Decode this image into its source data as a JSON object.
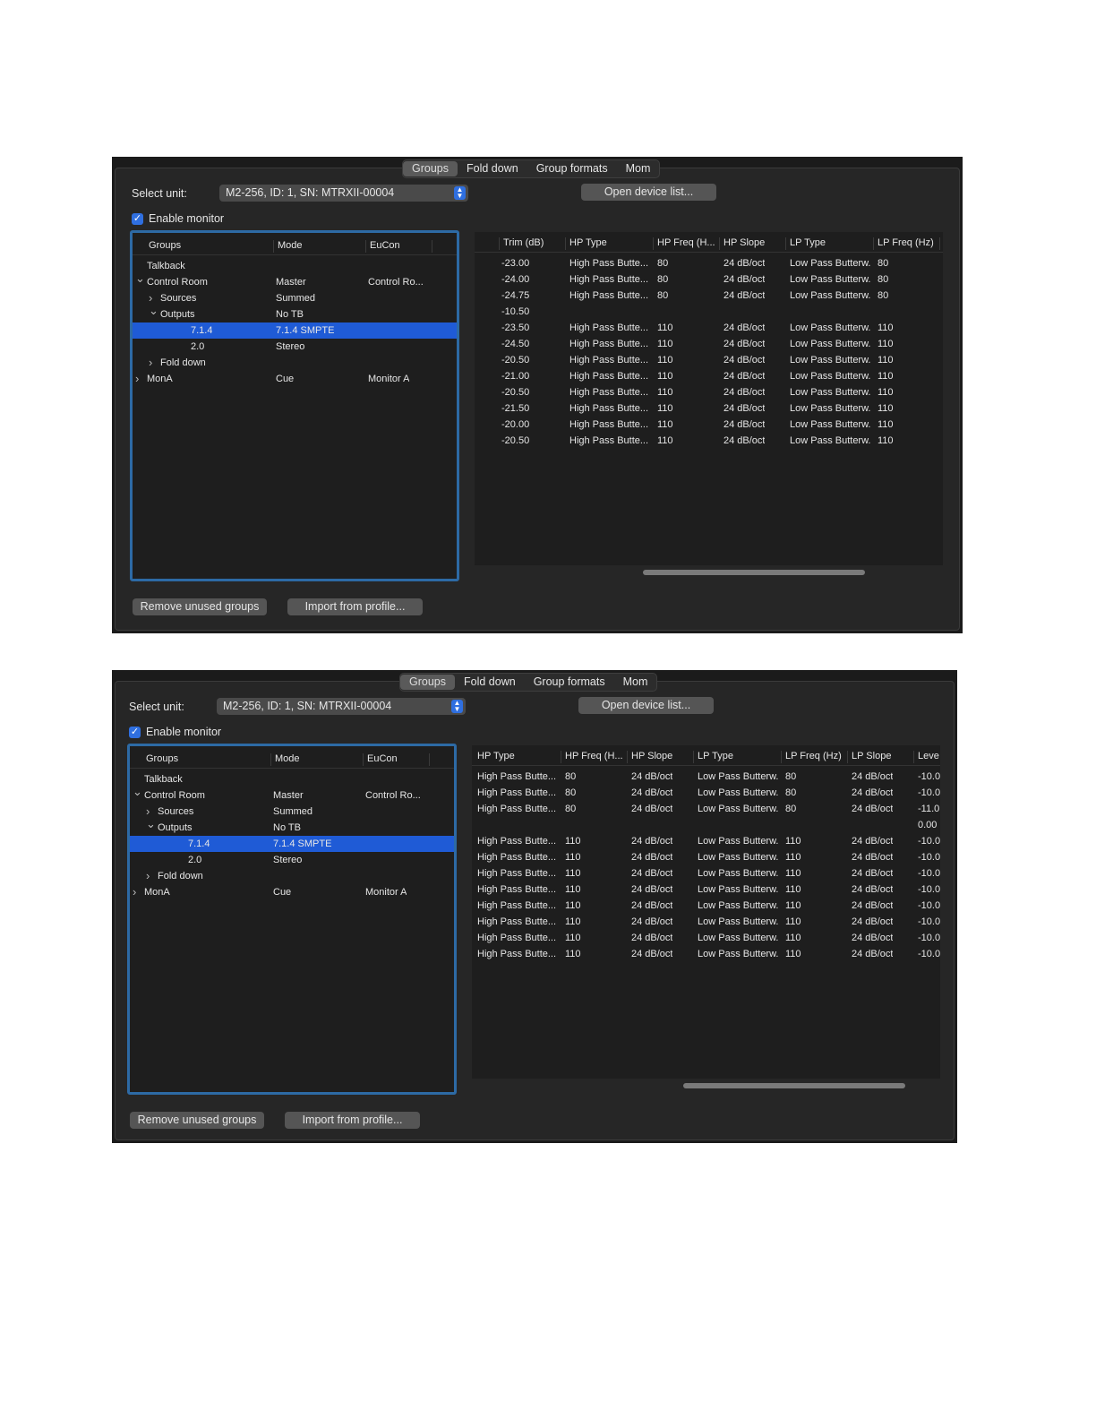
{
  "panels": [
    {
      "tabs": [
        "Groups",
        "Fold down",
        "Group formats",
        "Mom"
      ],
      "selected_tab": 0,
      "select_unit_label": "Select unit:",
      "unit_value": "M2-256, ID: 1, SN: MTRXII-00004",
      "open_device_list": "Open device list...",
      "enable_monitor": "Enable monitor",
      "enable_monitor_checked": true,
      "groups_table": {
        "columns": [
          "Groups",
          "Mode",
          "EuCon"
        ],
        "rows": [
          {
            "name": "Talkback",
            "mode": "",
            "eucon": "",
            "level": 0,
            "chevron": ""
          },
          {
            "name": "Control Room",
            "mode": "Master",
            "eucon": "Control Ro...",
            "level": 0,
            "chevron": "⌄"
          },
          {
            "name": "Sources",
            "mode": "Summed",
            "eucon": "",
            "level": 1,
            "chevron": "›"
          },
          {
            "name": "Outputs",
            "mode": "No TB",
            "eucon": "",
            "level": 1,
            "chevron": "⌄"
          },
          {
            "name": "7.1.4",
            "mode": "7.1.4 SMPTE",
            "eucon": "",
            "level": 2,
            "chevron": "",
            "selected": true
          },
          {
            "name": "2.0",
            "mode": "Stereo",
            "eucon": "",
            "level": 2,
            "chevron": ""
          },
          {
            "name": "Fold down",
            "mode": "",
            "eucon": "",
            "level": 1,
            "chevron": "›"
          },
          {
            "name": "MonA",
            "mode": "Cue",
            "eucon": "Monitor A",
            "level": 0,
            "chevron": "›"
          }
        ]
      },
      "channel_table": {
        "columns": [
          "Trim (dB)",
          "HP Type",
          "HP Freq (H...",
          "HP Slope",
          "LP Type",
          "LP Freq (Hz)"
        ],
        "rows": [
          [
            "-23.00",
            "High Pass Butte...",
            "80",
            "24 dB/oct",
            "Low Pass Butterw.",
            "80"
          ],
          [
            "-24.00",
            "High Pass Butte...",
            "80",
            "24 dB/oct",
            "Low Pass Butterw.",
            "80"
          ],
          [
            "-24.75",
            "High Pass Butte...",
            "80",
            "24 dB/oct",
            "Low Pass Butterw.",
            "80"
          ],
          [
            "-10.50",
            "",
            "",
            "",
            "",
            ""
          ],
          [
            "-23.50",
            "High Pass Butte...",
            "110",
            "24 dB/oct",
            "Low Pass Butterw.",
            "110"
          ],
          [
            "-24.50",
            "High Pass Butte...",
            "110",
            "24 dB/oct",
            "Low Pass Butterw.",
            "110"
          ],
          [
            "-20.50",
            "High Pass Butte...",
            "110",
            "24 dB/oct",
            "Low Pass Butterw.",
            "110"
          ],
          [
            "-21.00",
            "High Pass Butte...",
            "110",
            "24 dB/oct",
            "Low Pass Butterw.",
            "110"
          ],
          [
            "-20.50",
            "High Pass Butte...",
            "110",
            "24 dB/oct",
            "Low Pass Butterw.",
            "110"
          ],
          [
            "-21.50",
            "High Pass Butte...",
            "110",
            "24 dB/oct",
            "Low Pass Butterw.",
            "110"
          ],
          [
            "-20.00",
            "High Pass Butte...",
            "110",
            "24 dB/oct",
            "Low Pass Butterw.",
            "110"
          ],
          [
            "-20.50",
            "High Pass Butte...",
            "110",
            "24 dB/oct",
            "Low Pass Butterw.",
            "110"
          ]
        ]
      },
      "remove_unused": "Remove unused groups",
      "import_profile": "Import from profile..."
    },
    {
      "tabs": [
        "Groups",
        "Fold down",
        "Group formats",
        "Mom"
      ],
      "selected_tab": 0,
      "select_unit_label": "Select unit:",
      "unit_value": "M2-256, ID: 1, SN: MTRXII-00004",
      "open_device_list": "Open device list...",
      "enable_monitor": "Enable monitor",
      "enable_monitor_checked": true,
      "groups_table": {
        "columns": [
          "Groups",
          "Mode",
          "EuCon"
        ],
        "rows": [
          {
            "name": "Talkback",
            "mode": "",
            "eucon": "",
            "level": 0,
            "chevron": ""
          },
          {
            "name": "Control Room",
            "mode": "Master",
            "eucon": "Control Ro...",
            "level": 0,
            "chevron": "⌄"
          },
          {
            "name": "Sources",
            "mode": "Summed",
            "eucon": "",
            "level": 1,
            "chevron": "›"
          },
          {
            "name": "Outputs",
            "mode": "No TB",
            "eucon": "",
            "level": 1,
            "chevron": "⌄"
          },
          {
            "name": "7.1.4",
            "mode": "7.1.4 SMPTE",
            "eucon": "",
            "level": 2,
            "chevron": "",
            "selected": true
          },
          {
            "name": "2.0",
            "mode": "Stereo",
            "eucon": "",
            "level": 2,
            "chevron": ""
          },
          {
            "name": "Fold down",
            "mode": "",
            "eucon": "",
            "level": 1,
            "chevron": "›"
          },
          {
            "name": "MonA",
            "mode": "Cue",
            "eucon": "Monitor A",
            "level": 0,
            "chevron": "›"
          }
        ]
      },
      "channel_table": {
        "columns": [
          "HP Type",
          "HP Freq (H...",
          "HP Slope",
          "LP Type",
          "LP Freq (Hz)",
          "LP Slope",
          "Leve"
        ],
        "rows": [
          [
            "High Pass Butte...",
            "80",
            "24 dB/oct",
            "Low Pass Butterw.",
            "80",
            "24 dB/oct",
            "-10.0"
          ],
          [
            "High Pass Butte...",
            "80",
            "24 dB/oct",
            "Low Pass Butterw.",
            "80",
            "24 dB/oct",
            "-10.0"
          ],
          [
            "High Pass Butte...",
            "80",
            "24 dB/oct",
            "Low Pass Butterw.",
            "80",
            "24 dB/oct",
            "-11.0"
          ],
          [
            "",
            "",
            "",
            "",
            "",
            "",
            "0.00"
          ],
          [
            "High Pass Butte...",
            "110",
            "24 dB/oct",
            "Low Pass Butterw.",
            "110",
            "24 dB/oct",
            "-10.0"
          ],
          [
            "High Pass Butte...",
            "110",
            "24 dB/oct",
            "Low Pass Butterw.",
            "110",
            "24 dB/oct",
            "-10.0"
          ],
          [
            "High Pass Butte...",
            "110",
            "24 dB/oct",
            "Low Pass Butterw.",
            "110",
            "24 dB/oct",
            "-10.0"
          ],
          [
            "High Pass Butte...",
            "110",
            "24 dB/oct",
            "Low Pass Butterw.",
            "110",
            "24 dB/oct",
            "-10.0"
          ],
          [
            "High Pass Butte...",
            "110",
            "24 dB/oct",
            "Low Pass Butterw.",
            "110",
            "24 dB/oct",
            "-10.0"
          ],
          [
            "High Pass Butte...",
            "110",
            "24 dB/oct",
            "Low Pass Butterw.",
            "110",
            "24 dB/oct",
            "-10.0"
          ],
          [
            "High Pass Butte...",
            "110",
            "24 dB/oct",
            "Low Pass Butterw.",
            "110",
            "24 dB/oct",
            "-10.0"
          ],
          [
            "High Pass Butte...",
            "110",
            "24 dB/oct",
            "Low Pass Butterw.",
            "110",
            "24 dB/oct",
            "-10.0"
          ]
        ]
      },
      "remove_unused": "Remove unused groups",
      "import_profile": "Import from profile..."
    }
  ]
}
